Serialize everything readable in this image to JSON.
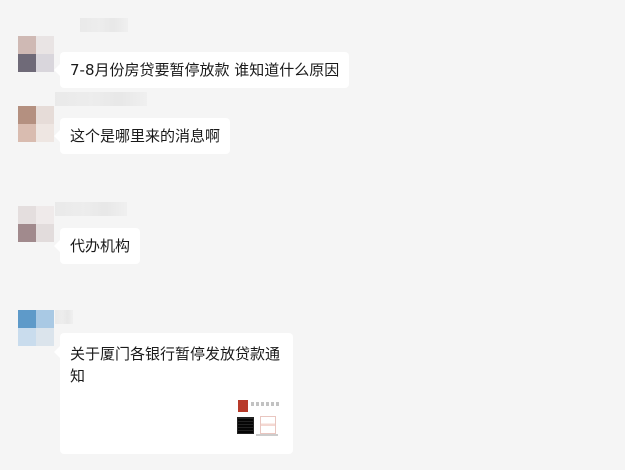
{
  "messages": [
    {
      "type": "text",
      "text": "7-8月份房贷要暂停放款 谁知道什么原因"
    },
    {
      "type": "text",
      "text": "这个是哪里来的消息啊"
    },
    {
      "type": "text",
      "text": "代办机构"
    },
    {
      "type": "link_card",
      "title": "关于厦门各银行暂停发放贷款通知"
    }
  ],
  "colors": {
    "chat_background": "#f5f5f5",
    "bubble_background": "#ffffff",
    "text": "#1a1a1a",
    "thumbnail_accent": "#b83a2a"
  }
}
